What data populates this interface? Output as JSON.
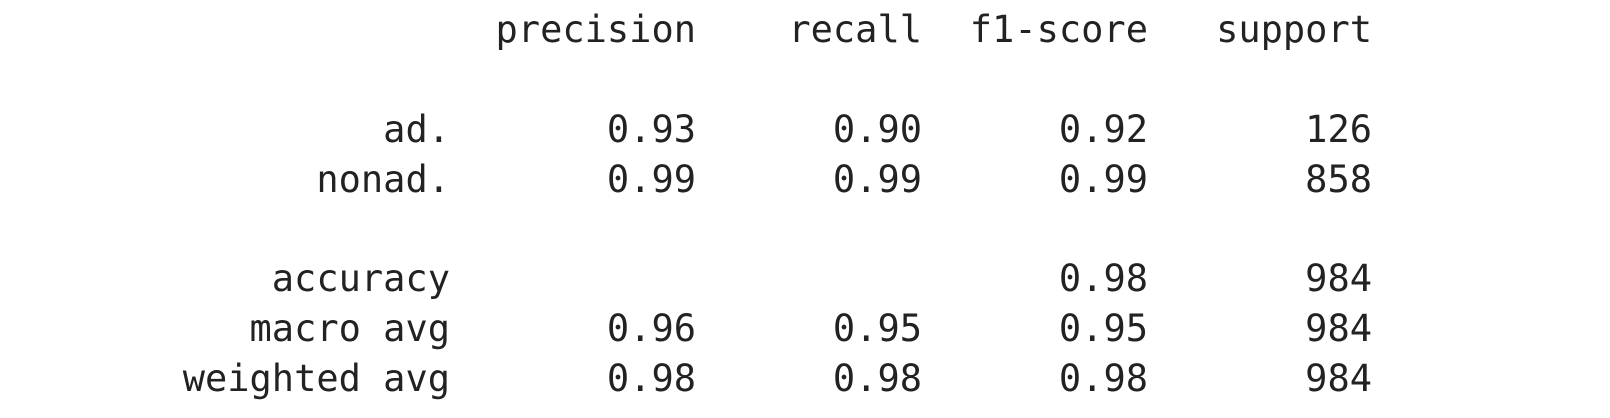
{
  "report": {
    "columns": [
      "precision",
      "recall",
      "f1-score",
      "support"
    ],
    "classes": [
      {
        "label": "ad.",
        "precision": "0.93",
        "recall": "0.90",
        "f1": "0.92",
        "support": "126"
      },
      {
        "label": "nonad.",
        "precision": "0.99",
        "recall": "0.99",
        "f1": "0.99",
        "support": "858"
      }
    ],
    "accuracy": {
      "label": "accuracy",
      "f1": "0.98",
      "support": "984"
    },
    "macro_avg": {
      "label": "macro avg",
      "precision": "0.96",
      "recall": "0.95",
      "f1": "0.95",
      "support": "984"
    },
    "weighted_avg": {
      "label": "weighted avg",
      "precision": "0.98",
      "recall": "0.98",
      "f1": "0.98",
      "support": "984"
    }
  }
}
